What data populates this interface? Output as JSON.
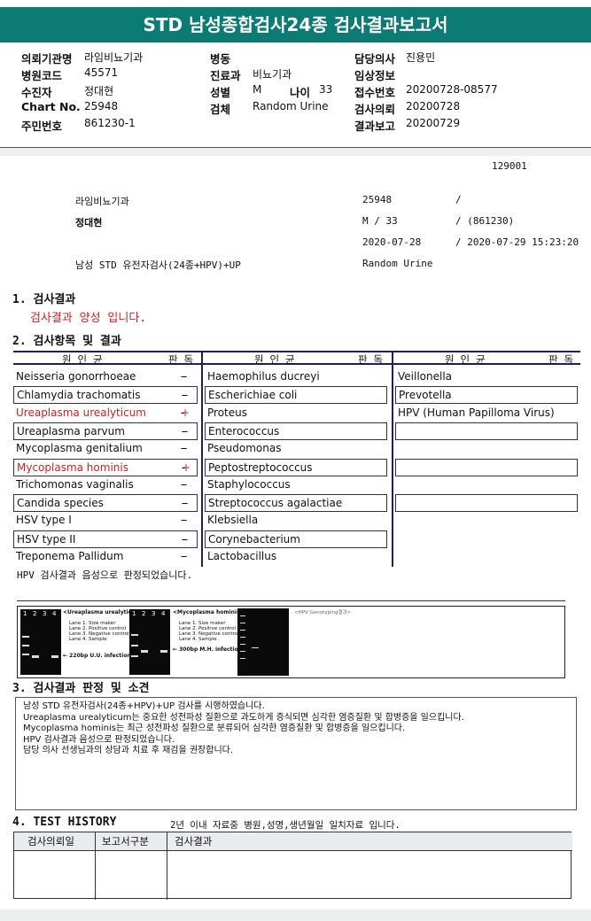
{
  "title": "STD 남성종합검사24종 검사결과보고서",
  "header": {
    "col1": [
      {
        "label": "의뢰기관명",
        "value": "라임비뇨기과"
      },
      {
        "label": "병원코드",
        "value": "45571"
      },
      {
        "label": "수진자",
        "value": "정대현"
      },
      {
        "label": "Chart No.",
        "value": "25948"
      },
      {
        "label": "주민번호",
        "value": "861230-1"
      }
    ],
    "col2": {
      "ward_label": "병동",
      "ward_value": "",
      "dept_label": "진료과",
      "dept_value": "비뇨기과",
      "sex_label": "성별",
      "sex_value": "M",
      "age_label": "나이",
      "age_value": "33",
      "specimen_label": "검체",
      "specimen_value": "Random Urine"
    },
    "col3": [
      {
        "label": "담당의사",
        "value": "진용민"
      },
      {
        "label": "임상정보",
        "value": ""
      },
      {
        "label": "접수번호",
        "value": "20200728-08577"
      },
      {
        "label": "검사의뢰",
        "value": "20200728"
      },
      {
        "label": "결과보고",
        "value": "20200729"
      }
    ]
  },
  "print": {
    "code": "129001",
    "hospital": "라임비뇨기과",
    "chart": "25948",
    "slash1": "/",
    "name": "정대현",
    "sex_age": "M  /  33",
    "birth": "/ (861230)",
    "receipt_date": "2020-07-28",
    "report_time": "/ 2020-07-29 15:23:20",
    "test_name": "남성 STD 유전자검사(24종+HPV)+UP",
    "specimen": "Random Urine"
  },
  "section1": {
    "title": "1. 검사결과",
    "result": "검사결과 양성 입니다."
  },
  "section2": {
    "title": "2. 검사항목 및 결과",
    "header_pathogen": "원 인 균",
    "header_result": "판 독",
    "columns": [
      [
        {
          "name": "Neisseria gonorrhoeae",
          "result": "-",
          "positive": false,
          "boxed": false
        },
        {
          "name": "Chlamydia trachomatis",
          "result": "-",
          "positive": false,
          "boxed": true
        },
        {
          "name": "Ureaplasma urealyticum",
          "result": "+",
          "positive": true,
          "boxed": false
        },
        {
          "name": "Ureaplasma parvum",
          "result": "-",
          "positive": false,
          "boxed": true
        },
        {
          "name": "Mycoplasma genitalium",
          "result": "-",
          "positive": false,
          "boxed": false
        },
        {
          "name": "Mycoplasma hominis",
          "result": "+",
          "positive": true,
          "boxed": true
        },
        {
          "name": "Trichomonas vaginalis",
          "result": "-",
          "positive": false,
          "boxed": false
        },
        {
          "name": "Candida species",
          "result": "-",
          "positive": false,
          "boxed": true
        },
        {
          "name": "HSV type I",
          "result": "-",
          "positive": false,
          "boxed": false
        },
        {
          "name": "HSV type II",
          "result": "-",
          "positive": false,
          "boxed": true
        },
        {
          "name": "Treponema Pallidum",
          "result": "-",
          "positive": false,
          "boxed": false
        }
      ],
      [
        {
          "name": "Haemophilus ducreyi",
          "result": "-",
          "positive": false,
          "boxed": false
        },
        {
          "name": "Escherichiae coli",
          "result": "-",
          "positive": false,
          "boxed": true
        },
        {
          "name": "Proteus",
          "result": "-",
          "positive": false,
          "boxed": false
        },
        {
          "name": "Enterococcus",
          "result": "-",
          "positive": false,
          "boxed": true
        },
        {
          "name": "Pseudomonas",
          "result": "-",
          "positive": false,
          "boxed": false
        },
        {
          "name": "Peptostreptococcus",
          "result": "-",
          "positive": false,
          "boxed": true
        },
        {
          "name": "Staphylococcus",
          "result": "-",
          "positive": false,
          "boxed": false
        },
        {
          "name": "Streptococcus agalactiae",
          "result": "-",
          "positive": false,
          "boxed": true
        },
        {
          "name": "Klebsiella",
          "result": "-",
          "positive": false,
          "boxed": false
        },
        {
          "name": "Corynebacterium",
          "result": "-",
          "positive": false,
          "boxed": true
        },
        {
          "name": "Lactobacillus",
          "result": "-",
          "positive": false,
          "boxed": false
        }
      ],
      [
        {
          "name": "Veillonella",
          "result": "-",
          "positive": false,
          "boxed": false
        },
        {
          "name": "Prevotella",
          "result": "-",
          "positive": false,
          "boxed": true
        },
        {
          "name": "HPV (Human Papilloma Virus)",
          "result": "-",
          "positive": false,
          "boxed": false
        },
        {
          "name": "",
          "result": "",
          "positive": false,
          "boxed": true
        },
        {
          "name": "",
          "result": "",
          "positive": false,
          "boxed": false
        },
        {
          "name": "",
          "result": "",
          "positive": false,
          "boxed": true
        },
        {
          "name": "",
          "result": "",
          "positive": false,
          "boxed": false
        },
        {
          "name": "",
          "result": "",
          "positive": false,
          "boxed": true
        },
        {
          "name": "",
          "result": "",
          "positive": false,
          "boxed": false
        },
        {
          "name": "",
          "result": "",
          "positive": false,
          "boxed": false
        },
        {
          "name": "",
          "result": "",
          "positive": false,
          "boxed": false
        }
      ]
    ],
    "hpv_note": "HPV 검사결과 음성으로 판정되었습니다."
  },
  "gel": {
    "lanes": [
      "1",
      "2",
      "3",
      "4"
    ],
    "panel1_title": "<Ureaplasma urealyticum>",
    "panel1_legend": [
      "Lane 1. Size maker",
      "Lane 2. Positive control",
      "Lane 3. Negative control",
      "Lane 4. Sample"
    ],
    "panel1_arrow": "220bp U.U. infection",
    "panel2_title": "<Mycoplasma hominis>",
    "panel2_legend": [
      "Lane 1. Size maker",
      "Lane 2. Positive control",
      "Lane 3. Negative control",
      "Lane 4. Sample"
    ],
    "panel2_arrow": "300bp M.H. infection",
    "panel3_title": "<HPV Genotyping결과>"
  },
  "section3": {
    "title": "3. 검사결과 판정 및 소견",
    "lines": [
      "남성 STD 유전자검사(24종+HPV)+UP 검사를 시행하였습니다.",
      "Ureaplasma urealyticum는 중요한 성전파성 질환으로 과도하게 증식되면 심각한 염증질환 및 합병증을 일으킵니다.",
      "Mycoplasma hominis는 최근 성전파성 질환으로 분류되어 심각한 염증질환 및 합병증을 일으킵니다.",
      "HPV 검사결과 음성으로 판정되었습니다.",
      "담당 의사 선생님과의 상담과 치료 후 재검을 권장합니다."
    ]
  },
  "section4": {
    "title": "4. TEST HISTORY",
    "note": "2년 이내 자료중 병원,성명,생년월일 일치자료 입니다.",
    "col_request": "검사의뢰일",
    "col_type": "보고서구분",
    "col_result": "검사결과"
  }
}
